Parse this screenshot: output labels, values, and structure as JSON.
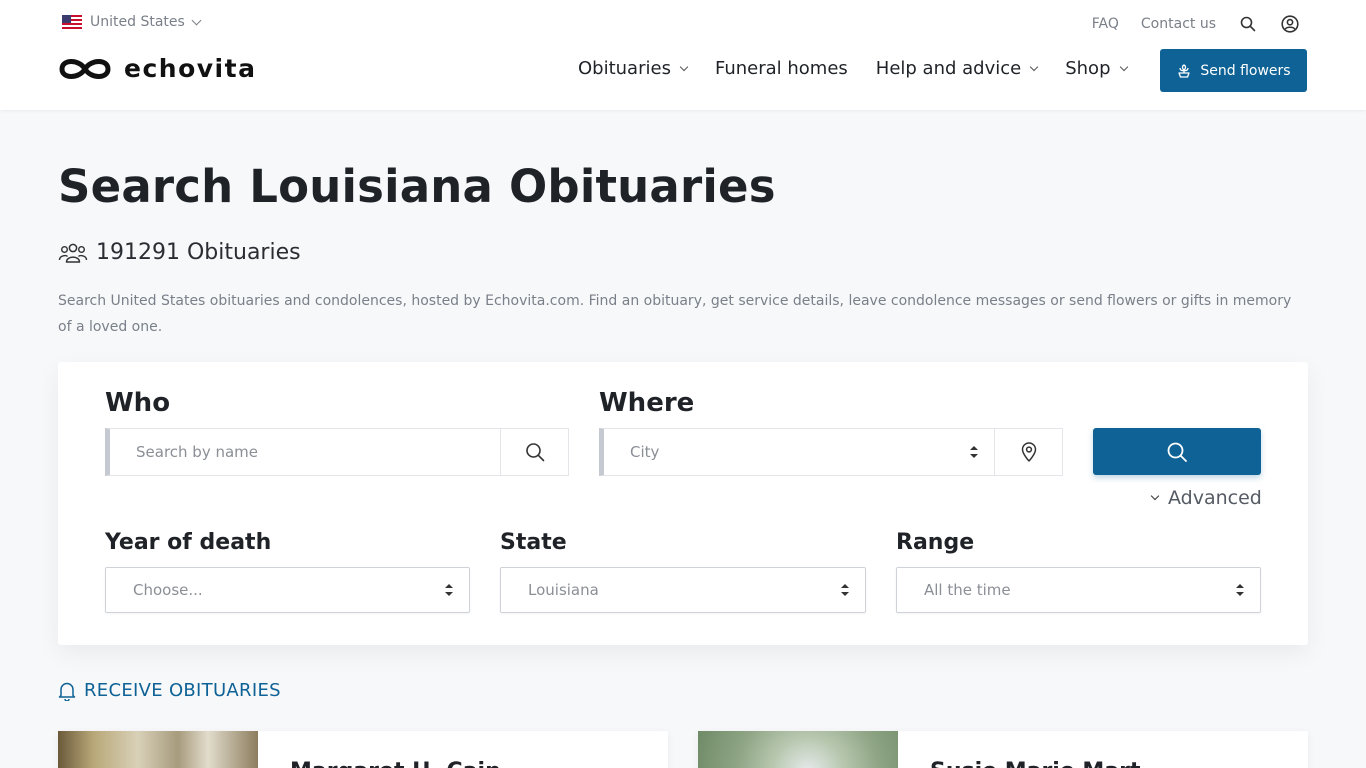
{
  "header": {
    "country": "United States",
    "logo_text": "echovita",
    "top_links": {
      "faq": "FAQ",
      "contact": "Contact us"
    },
    "nav": [
      {
        "label": "Obituaries",
        "has_dropdown": true
      },
      {
        "label": "Funeral homes",
        "has_dropdown": false
      },
      {
        "label": "Help and advice",
        "has_dropdown": true
      },
      {
        "label": "Shop",
        "has_dropdown": true
      }
    ],
    "send_flowers": "Send flowers"
  },
  "page": {
    "title": "Search Louisiana Obituaries",
    "count": "191291 Obituaries",
    "description": "Search United States obituaries and condolences, hosted by Echovita.com. Find an obituary, get service details, leave condolence messages or send flowers or gifts in memory of a loved one."
  },
  "search": {
    "who_label": "Who",
    "who_placeholder": "Search by name",
    "where_label": "Where",
    "city_value": "City",
    "advanced_label": "Advanced",
    "year_label": "Year of death",
    "year_value": "Choose...",
    "state_label": "State",
    "state_value": "Louisiana",
    "range_label": "Range",
    "range_value": "All the time"
  },
  "receive_label": "RECEIVE OBITUARIES",
  "obituaries": [
    {
      "name": "Margaret H. Cain"
    },
    {
      "name": "Susie Marie Mart"
    }
  ],
  "colors": {
    "primary": "#0e6295",
    "text": "#1f2328",
    "muted": "#7a8089",
    "background": "#f7f8fa"
  }
}
